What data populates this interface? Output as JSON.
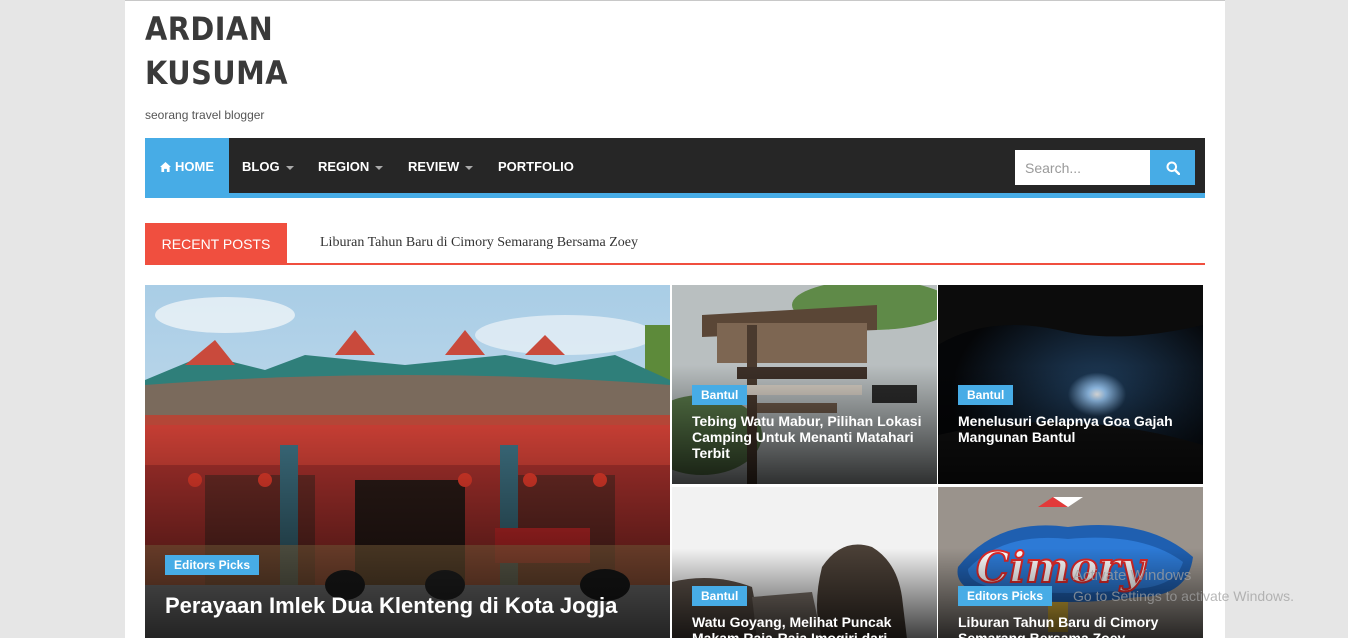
{
  "site": {
    "title_line1": "ARDIAN",
    "title_line2": "KUSUMA",
    "tagline": "seorang travel blogger"
  },
  "nav": {
    "home": "HOME",
    "blog": "BLOG",
    "region": "REGION",
    "review": "REVIEW",
    "portfolio": "PORTFOLIO",
    "search_placeholder": "Search..."
  },
  "recent": {
    "label": "RECENT POSTS",
    "ticker": "Liburan Tahun Baru di Cimory Semarang Bersama Zoey"
  },
  "posts": [
    {
      "badge": "Editors Picks",
      "title": "Perayaan Imlek Dua Klenteng di Kota Jogja"
    },
    {
      "badge": "Bantul",
      "title": "Tebing Watu Mabur, Pilihan Lokasi Camping Untuk Menanti Matahari Terbit"
    },
    {
      "badge": "Bantul",
      "title": "Menelusuri Gelapnya Goa Gajah Mangunan Bantul"
    },
    {
      "badge": "Bantul",
      "title": "Watu Goyang, Melihat Puncak Makam Raja-Raja Imogiri dari"
    },
    {
      "badge": "Editors Picks",
      "title": "Liburan Tahun Baru di Cimory Semarang Bersama Zoey"
    }
  ],
  "os_overlay": {
    "line1": "Activate Windows",
    "line2": "Go to Settings to activate Windows."
  },
  "colors": {
    "accent_blue": "#47ace6",
    "accent_red": "#f04f3f",
    "nav_bg": "#262626"
  }
}
